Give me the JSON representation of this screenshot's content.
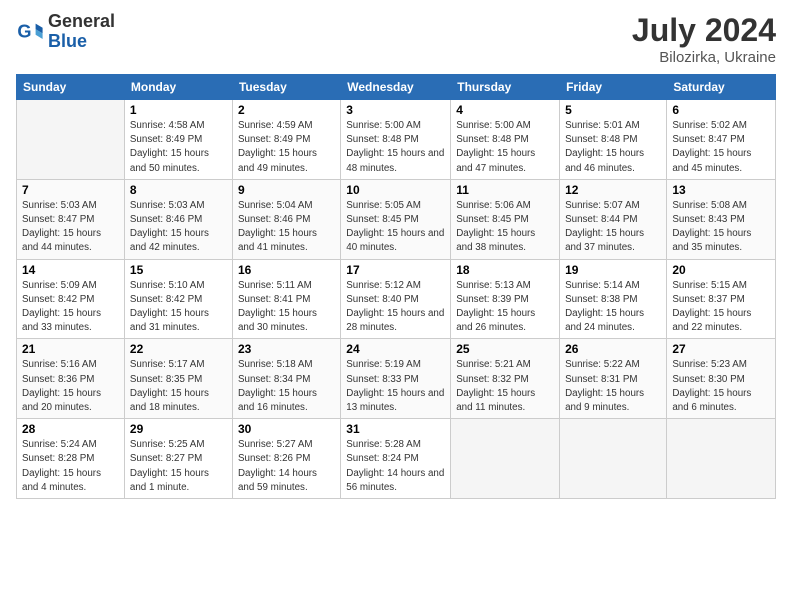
{
  "logo": {
    "general": "General",
    "blue": "Blue"
  },
  "header": {
    "month_year": "July 2024",
    "location": "Bilozirka, Ukraine"
  },
  "days_header": [
    "Sunday",
    "Monday",
    "Tuesday",
    "Wednesday",
    "Thursday",
    "Friday",
    "Saturday"
  ],
  "weeks": [
    [
      {
        "day": "",
        "empty": true
      },
      {
        "day": "1",
        "sunrise": "4:58 AM",
        "sunset": "8:49 PM",
        "daylight": "15 hours and 50 minutes."
      },
      {
        "day": "2",
        "sunrise": "4:59 AM",
        "sunset": "8:49 PM",
        "daylight": "15 hours and 49 minutes."
      },
      {
        "day": "3",
        "sunrise": "5:00 AM",
        "sunset": "8:48 PM",
        "daylight": "15 hours and 48 minutes."
      },
      {
        "day": "4",
        "sunrise": "5:00 AM",
        "sunset": "8:48 PM",
        "daylight": "15 hours and 47 minutes."
      },
      {
        "day": "5",
        "sunrise": "5:01 AM",
        "sunset": "8:48 PM",
        "daylight": "15 hours and 46 minutes."
      },
      {
        "day": "6",
        "sunrise": "5:02 AM",
        "sunset": "8:47 PM",
        "daylight": "15 hours and 45 minutes."
      }
    ],
    [
      {
        "day": "7",
        "sunrise": "5:03 AM",
        "sunset": "8:47 PM",
        "daylight": "15 hours and 44 minutes."
      },
      {
        "day": "8",
        "sunrise": "5:03 AM",
        "sunset": "8:46 PM",
        "daylight": "15 hours and 42 minutes."
      },
      {
        "day": "9",
        "sunrise": "5:04 AM",
        "sunset": "8:46 PM",
        "daylight": "15 hours and 41 minutes."
      },
      {
        "day": "10",
        "sunrise": "5:05 AM",
        "sunset": "8:45 PM",
        "daylight": "15 hours and 40 minutes."
      },
      {
        "day": "11",
        "sunrise": "5:06 AM",
        "sunset": "8:45 PM",
        "daylight": "15 hours and 38 minutes."
      },
      {
        "day": "12",
        "sunrise": "5:07 AM",
        "sunset": "8:44 PM",
        "daylight": "15 hours and 37 minutes."
      },
      {
        "day": "13",
        "sunrise": "5:08 AM",
        "sunset": "8:43 PM",
        "daylight": "15 hours and 35 minutes."
      }
    ],
    [
      {
        "day": "14",
        "sunrise": "5:09 AM",
        "sunset": "8:42 PM",
        "daylight": "15 hours and 33 minutes."
      },
      {
        "day": "15",
        "sunrise": "5:10 AM",
        "sunset": "8:42 PM",
        "daylight": "15 hours and 31 minutes."
      },
      {
        "day": "16",
        "sunrise": "5:11 AM",
        "sunset": "8:41 PM",
        "daylight": "15 hours and 30 minutes."
      },
      {
        "day": "17",
        "sunrise": "5:12 AM",
        "sunset": "8:40 PM",
        "daylight": "15 hours and 28 minutes."
      },
      {
        "day": "18",
        "sunrise": "5:13 AM",
        "sunset": "8:39 PM",
        "daylight": "15 hours and 26 minutes."
      },
      {
        "day": "19",
        "sunrise": "5:14 AM",
        "sunset": "8:38 PM",
        "daylight": "15 hours and 24 minutes."
      },
      {
        "day": "20",
        "sunrise": "5:15 AM",
        "sunset": "8:37 PM",
        "daylight": "15 hours and 22 minutes."
      }
    ],
    [
      {
        "day": "21",
        "sunrise": "5:16 AM",
        "sunset": "8:36 PM",
        "daylight": "15 hours and 20 minutes."
      },
      {
        "day": "22",
        "sunrise": "5:17 AM",
        "sunset": "8:35 PM",
        "daylight": "15 hours and 18 minutes."
      },
      {
        "day": "23",
        "sunrise": "5:18 AM",
        "sunset": "8:34 PM",
        "daylight": "15 hours and 16 minutes."
      },
      {
        "day": "24",
        "sunrise": "5:19 AM",
        "sunset": "8:33 PM",
        "daylight": "15 hours and 13 minutes."
      },
      {
        "day": "25",
        "sunrise": "5:21 AM",
        "sunset": "8:32 PM",
        "daylight": "15 hours and 11 minutes."
      },
      {
        "day": "26",
        "sunrise": "5:22 AM",
        "sunset": "8:31 PM",
        "daylight": "15 hours and 9 minutes."
      },
      {
        "day": "27",
        "sunrise": "5:23 AM",
        "sunset": "8:30 PM",
        "daylight": "15 hours and 6 minutes."
      }
    ],
    [
      {
        "day": "28",
        "sunrise": "5:24 AM",
        "sunset": "8:28 PM",
        "daylight": "15 hours and 4 minutes."
      },
      {
        "day": "29",
        "sunrise": "5:25 AM",
        "sunset": "8:27 PM",
        "daylight": "15 hours and 1 minute."
      },
      {
        "day": "30",
        "sunrise": "5:27 AM",
        "sunset": "8:26 PM",
        "daylight": "14 hours and 59 minutes."
      },
      {
        "day": "31",
        "sunrise": "5:28 AM",
        "sunset": "8:24 PM",
        "daylight": "14 hours and 56 minutes."
      },
      {
        "day": "",
        "empty": true
      },
      {
        "day": "",
        "empty": true
      },
      {
        "day": "",
        "empty": true
      }
    ]
  ]
}
